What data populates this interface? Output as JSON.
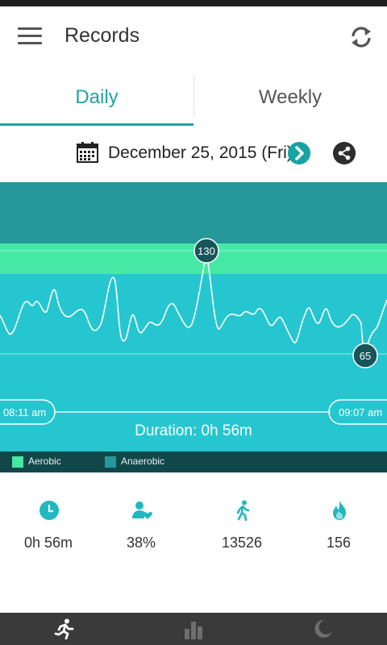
{
  "header": {
    "title": "Records",
    "menu_icon": "menu-icon",
    "sync_icon": "sync-icon"
  },
  "tabs": [
    {
      "label": "Daily",
      "active": true
    },
    {
      "label": "Weekly",
      "active": false
    }
  ],
  "date_bar": {
    "date": "December 25, 2015 (Fri)",
    "calendar_icon": "calendar-icon",
    "next_icon": "chevron-right-icon",
    "share_icon": "share-icon"
  },
  "colors": {
    "accent": "#21a3a0",
    "chart_bg": "#26c6d0",
    "anaerobic_band": "#26979a",
    "aerobic_band": "#45e8a4",
    "legend_bg": "#12474a"
  },
  "chart_data": {
    "type": "line",
    "max_label": "130",
    "min_label": "65",
    "start_time": "08:11 am",
    "end_time": "09:07 am",
    "duration_label": "Duration: 0h 56m",
    "legend": [
      {
        "name": "Aerobic",
        "color": "#45e8a4"
      },
      {
        "name": "Anaerobic",
        "color": "#26979a"
      }
    ]
  },
  "stats": [
    {
      "icon": "clock-icon",
      "value": "0h 56m"
    },
    {
      "icon": "person-heart-icon",
      "value": "38%"
    },
    {
      "icon": "walking-icon",
      "value": "13526"
    },
    {
      "icon": "flame-icon",
      "value": "156"
    }
  ],
  "bottom_nav": [
    {
      "icon": "running-icon",
      "active": true
    },
    {
      "icon": "bar-chart-icon",
      "active": false
    },
    {
      "icon": "moon-icon",
      "active": false
    }
  ]
}
